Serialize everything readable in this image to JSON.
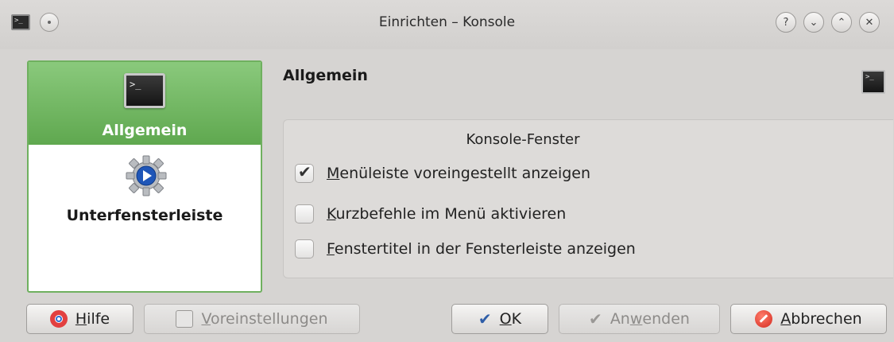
{
  "window": {
    "title": "Einrichten – Konsole",
    "controls": [
      "?",
      "⌄",
      "⌃",
      "✕"
    ]
  },
  "sidebar": {
    "items": [
      {
        "label": "Allgemein",
        "icon": "terminal-icon",
        "selected": true
      },
      {
        "label": "Unterfensterleiste",
        "icon": "gear-play-icon",
        "selected": false
      }
    ]
  },
  "main": {
    "title": "Allgemein",
    "group": {
      "title": "Konsole-Fenster",
      "options": [
        {
          "mnemonic": "M",
          "rest": "enüleiste voreingestellt anzeigen",
          "checked": true
        },
        {
          "mnemonic": "K",
          "rest": "urzbefehle im Menü aktivieren",
          "checked": false
        },
        {
          "mnemonic": "F",
          "rest": "enstertitel in der Fensterleiste anzeigen",
          "checked": false
        }
      ]
    }
  },
  "buttons": {
    "help": {
      "mnemonic": "H",
      "rest": "ilfe"
    },
    "defaults": {
      "mnemonic": "V",
      "rest": "oreinstellungen",
      "enabled": false
    },
    "ok": {
      "mnemonic": "O",
      "rest": "K"
    },
    "apply": {
      "pre": "An",
      "mnemonic": "w",
      "rest": "enden",
      "enabled": false
    },
    "cancel": {
      "mnemonic": "A",
      "rest": "bbrechen"
    }
  },
  "colors": {
    "selection": "#6fb05f",
    "background": "#d6d4d2",
    "cancel_icon": "#d42a1f",
    "ok_check": "#2f5ea8"
  }
}
